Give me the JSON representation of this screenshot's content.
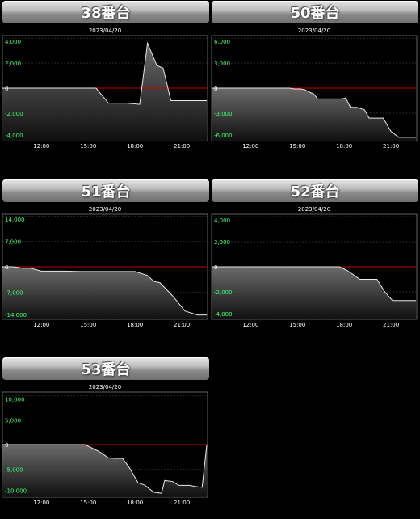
{
  "chart_data": [
    {
      "type": "area",
      "title": "38番台",
      "subtitle": "2023/04/20",
      "x": [
        "09:30",
        "10:00",
        "10:30",
        "11:00",
        "11:30",
        "12:00",
        "12:30",
        "13:00",
        "13:30",
        "14:00",
        "14:30",
        "15:00",
        "15:30",
        "16:00",
        "16:30",
        "17:00",
        "17:30",
        "18:00",
        "18:30",
        "19:00",
        "19:30",
        "20:00",
        "20:30",
        "21:00",
        "21:30",
        "22:00",
        "22:40"
      ],
      "xticks": [
        "12:00",
        "15:00",
        "18:00",
        "21:00"
      ],
      "yticks": [
        4000,
        2000,
        0,
        -2000,
        -4000
      ],
      "ytick_labels": [
        "4,000",
        "2,000",
        "0",
        "-2,000",
        "-4,000"
      ],
      "ylim": [
        -4200,
        4200
      ],
      "values": [
        0,
        0,
        0,
        0,
        0,
        0,
        0,
        0,
        0,
        0,
        0,
        0,
        0,
        -1200,
        -1200,
        -1200,
        -1300,
        3600,
        1800,
        1600,
        -1000,
        -1000,
        -1000,
        -1000,
        -1000,
        -1000,
        -1000
      ],
      "series_x": [
        9.5,
        10,
        10.5,
        11,
        11.5,
        12,
        12.5,
        13,
        13.5,
        14,
        14.5,
        15,
        15.5,
        16.3,
        16.6,
        17.5,
        18.3,
        18.8,
        19.4,
        19.8,
        20.3,
        20.5,
        21,
        21.5,
        22,
        22.3,
        22.6
      ]
    },
    {
      "type": "area",
      "title": "50番台",
      "subtitle": "2023/04/20",
      "xticks": [
        "12:00",
        "15:00",
        "18:00",
        "21:00"
      ],
      "yticks": [
        6000,
        3000,
        0,
        -3000,
        -6000
      ],
      "ytick_labels": [
        "6,000",
        "3,000",
        "0",
        "-3,000",
        "-6,000"
      ],
      "ylim": [
        -6300,
        6300
      ],
      "values": [
        0,
        0,
        0,
        0,
        0,
        0,
        -100,
        -100,
        -200,
        -600,
        -600,
        -1300,
        -1300,
        -1300,
        -1200,
        -2300,
        -2300,
        -2600,
        -3600,
        -3600,
        -3600,
        -5200,
        -5900,
        -5900,
        -5900
      ],
      "series_x": [
        9.5,
        10.5,
        11.5,
        12.5,
        13.5,
        14.5,
        14.8,
        15.2,
        15.5,
        15.9,
        16,
        16.3,
        17,
        17.8,
        18.1,
        18.4,
        18.8,
        19.3,
        19.6,
        20,
        20.5,
        21,
        21.5,
        22,
        22.6
      ]
    },
    {
      "type": "area",
      "title": "51番台",
      "subtitle": "2023/04/20",
      "xticks": [
        "12:00",
        "15:00",
        "18:00",
        "21:00"
      ],
      "yticks": [
        14000,
        7000,
        0,
        -7000,
        -14000
      ],
      "ytick_labels": [
        "14,000",
        "7,000",
        "0",
        "-7,000",
        "-14,000"
      ],
      "ylim": [
        -14500,
        14500
      ],
      "values": [
        0,
        0,
        -400,
        -400,
        -1200,
        -1200,
        -1200,
        -1300,
        -1300,
        -1300,
        -1300,
        -1300,
        -1300,
        -2400,
        -4000,
        -4400,
        -8000,
        -12200,
        -13300,
        -13300
      ],
      "series_x": [
        9.5,
        10.2,
        10.8,
        11.3,
        12,
        12.5,
        13.5,
        14.5,
        15.5,
        16.5,
        17,
        17.5,
        18,
        18.8,
        19.2,
        19.6,
        20.4,
        21.2,
        22,
        22.6
      ]
    },
    {
      "type": "area",
      "title": "52番台",
      "subtitle": "2023/04/20",
      "xticks": [
        "12:00",
        "15:00",
        "18:00",
        "21:00"
      ],
      "yticks": [
        4000,
        2000,
        0,
        -2000,
        -4000
      ],
      "ytick_labels": [
        "4,000",
        "2,000",
        "0",
        "-2,000",
        "-4,000"
      ],
      "ylim": [
        -4200,
        4200
      ],
      "values": [
        0,
        0,
        0,
        0,
        0,
        0,
        0,
        0,
        -300,
        -1000,
        -1000,
        -1000,
        -2000,
        -2700,
        -2700,
        -2700
      ],
      "series_x": [
        9.5,
        10.5,
        11.5,
        12.5,
        13.5,
        14.5,
        15.5,
        17.7,
        18.2,
        19,
        19.6,
        20.1,
        20.6,
        21.1,
        21.8,
        22.6
      ]
    },
    {
      "type": "area",
      "title": "53番台",
      "subtitle": "2023/04/20",
      "xticks": [
        "12:00",
        "15:00",
        "18:00",
        "21:00"
      ],
      "yticks": [
        10000,
        5000,
        0,
        -5000,
        -10000
      ],
      "ytick_labels": [
        "10,000",
        "5,000",
        "0",
        "-5,000",
        "-10,000"
      ],
      "ylim": [
        -10700,
        10700
      ],
      "values": [
        0,
        0,
        0,
        0,
        0,
        0,
        -1400,
        -2700,
        -2800,
        -2800,
        -4500,
        -7800,
        -8200,
        -9700,
        -9900,
        -7300,
        -7500,
        -8300,
        -8300,
        -8500,
        -8700,
        0
      ],
      "series_x": [
        9.5,
        10.5,
        11.5,
        12.5,
        13.5,
        14.8,
        15.7,
        16.3,
        16.7,
        17.2,
        17.6,
        18.2,
        18.6,
        19.2,
        19.7,
        19.9,
        20.4,
        20.8,
        21.5,
        21.8,
        22.3,
        22.6
      ]
    }
  ]
}
